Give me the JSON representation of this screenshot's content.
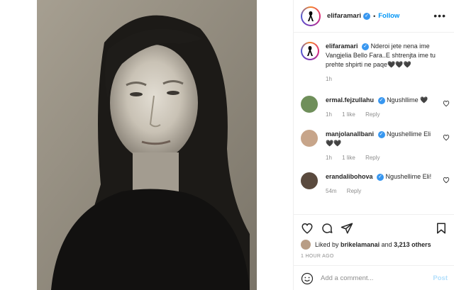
{
  "post": {
    "author": "elifaramari",
    "follow_label": "Follow",
    "dot": "•",
    "more_label": "•••"
  },
  "caption": {
    "username": "elifaramari",
    "text": "Nderoi jete nena ime Vangjelia Bello Fara..E shtrenjta ime tu prehte shpirti ne paqe🖤🖤🖤",
    "time": "1h"
  },
  "comments": [
    {
      "username": "ermal.fejzullahu",
      "verified": true,
      "text": "Ngushllime 🖤",
      "time": "1h",
      "likes": "1 like",
      "reply": "Reply"
    },
    {
      "username": "manjolanallbani",
      "verified": true,
      "text": "Ngushellime Eli 🖤🖤",
      "time": "1h",
      "likes": "1 like",
      "reply": "Reply"
    },
    {
      "username": "erandalibohova",
      "verified": true,
      "text": "Ngushellime Eli!",
      "time": "54m",
      "reply": "Reply"
    }
  ],
  "likes": {
    "prefix": "Liked by",
    "user": "brikelamanai",
    "connector": "and",
    "count": "3,213 others"
  },
  "timestamp": "1 HOUR AGO",
  "add_comment": {
    "placeholder": "Add a comment...",
    "post_label": "Post"
  },
  "colors": {
    "accent": "#0095f6",
    "verified": "#3897f0",
    "muted": "#8e8e8e"
  },
  "icons": [
    "ribbon-icon",
    "verified-icon",
    "heart-icon",
    "comment-icon",
    "share-icon",
    "bookmark-icon",
    "emoji-icon"
  ]
}
